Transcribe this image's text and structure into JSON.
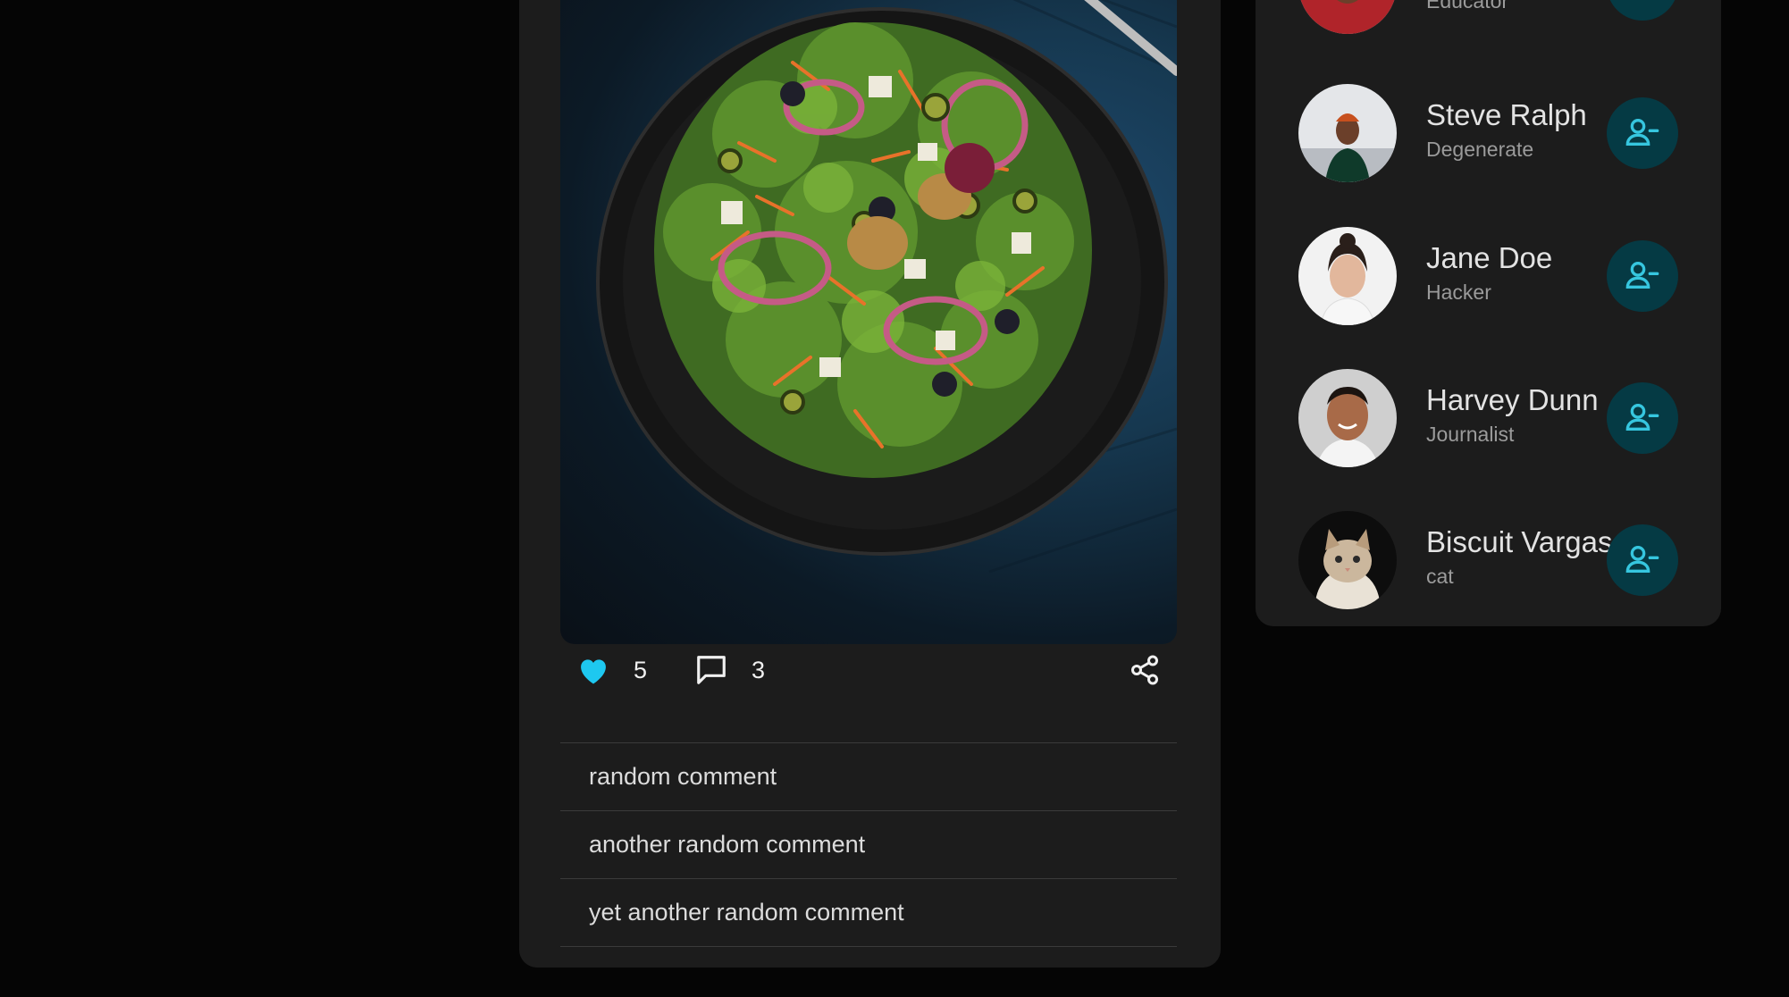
{
  "post": {
    "image_alt": "salad bowl",
    "likes": "5",
    "comments_count": "3",
    "comments": [
      "random comment",
      "another random comment",
      "yet another random comment"
    ]
  },
  "suggestions": [
    {
      "name": "",
      "role": "Educator"
    },
    {
      "name": "Steve Ralph",
      "role": "Degenerate"
    },
    {
      "name": "Jane Doe",
      "role": "Hacker"
    },
    {
      "name": "Harvey Dunn",
      "role": "Journalist"
    },
    {
      "name": "Biscuit Vargas",
      "role": "cat"
    }
  ],
  "colors": {
    "background": "#050505",
    "card": "#1c1c1c",
    "like_accent": "#1ec8f0",
    "follow_button": "#053a44",
    "follow_icon": "#36c6df"
  },
  "icons": {
    "like": "heart-icon",
    "comment": "comment-icon",
    "share": "share-icon",
    "unfollow": "user-minus-icon"
  }
}
